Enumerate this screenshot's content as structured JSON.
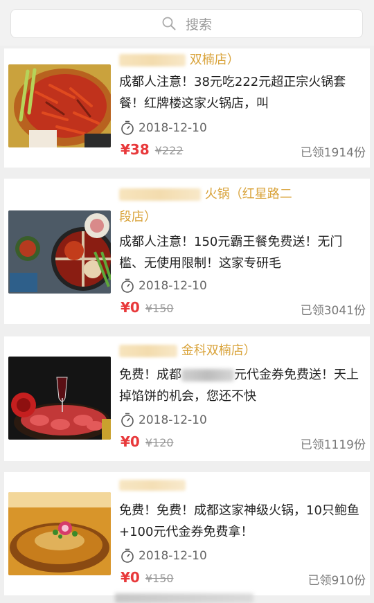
{
  "search": {
    "placeholder": "搜索",
    "icon": "search-icon"
  },
  "colors": {
    "accent": "#d9a33a",
    "price": "#e8393b",
    "background": "#efefef"
  },
  "items": [
    {
      "store_visible": "双楠店）",
      "description": "成都人注意！38元吃222元超正宗火锅套餐！红牌楼这家火锅店，叫",
      "date": "2018-12-10",
      "price": "¥38",
      "original_price": "¥222",
      "claimed": "已领1914份"
    },
    {
      "store_line1": "火锅（红星路二",
      "store_line2": "段店）",
      "description": "成都人注意！150元霸王餐免费送！无门槛、无使用限制！这家专研毛",
      "date": "2018-12-10",
      "price": "¥0",
      "original_price": "¥150",
      "claimed": "已领3041份"
    },
    {
      "store_visible": "金科双楠店）",
      "description_start": "免费！成都",
      "description_end": "元代金券免费送！天上掉馅饼的机会，您还不快",
      "date": "2018-12-10",
      "price": "¥0",
      "original_price": "¥120",
      "claimed": "已领1119份"
    },
    {
      "description": "免费！免费！成都这家神级火锅，10只鲍鱼+100元代金券免费拿！",
      "date": "2018-12-10",
      "price": "¥0",
      "original_price": "¥150",
      "claimed": "已领910份"
    }
  ]
}
